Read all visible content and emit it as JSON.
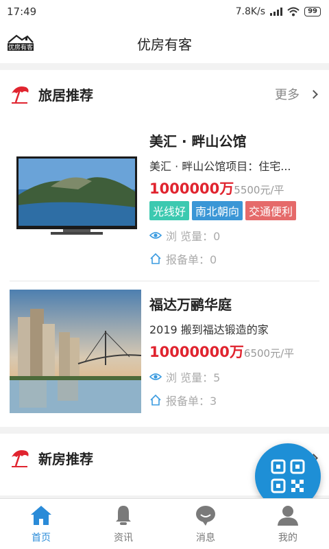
{
  "status": {
    "time": "17:49",
    "speed": "7.8K/s",
    "battery": "99"
  },
  "header": {
    "title": "优房有客",
    "logo_text": "优房有客"
  },
  "travel_section": {
    "title": "旅居推荐",
    "more_label": "更多",
    "listings": [
      {
        "name": "美汇 · 畔山公馆",
        "desc": "美汇 · 畔山公馆项目：住宅...",
        "price": "1000000万",
        "unit_price": "5500元/平",
        "tags": [
          "光线好",
          "南北朝向",
          "交通便利"
        ],
        "views": "浏 览量：0",
        "reports": "报备单：0"
      },
      {
        "name": "福达万鹂华庭",
        "desc": "2019 搬到福达锻造的家",
        "price": "10000000万",
        "unit_price": "6500元/平",
        "tags": [],
        "views": "浏 览量：5",
        "reports": "报备单：3"
      }
    ]
  },
  "new_section": {
    "title": "新房推荐"
  },
  "tabs": [
    {
      "label": "首页",
      "icon": "home-icon"
    },
    {
      "label": "资讯",
      "icon": "bell-icon"
    },
    {
      "label": "消息",
      "icon": "chat-icon"
    },
    {
      "label": "我的",
      "icon": "user-icon"
    }
  ],
  "colors": {
    "accent": "#2a8bd8",
    "price": "#e0242f",
    "tag_good_light": "#3cc9b0",
    "tag_orientation": "#3a96d6",
    "tag_transport": "#e56a6a",
    "fab": "#1e8fd6"
  }
}
